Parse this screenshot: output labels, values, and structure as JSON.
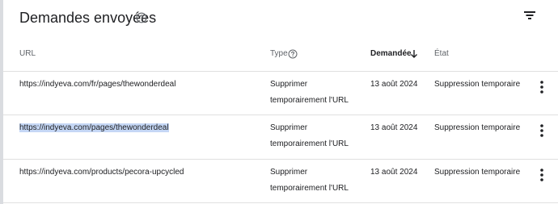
{
  "header": {
    "title": "Demandes envoyées",
    "help_icon": "help-circle-icon",
    "filter_icon": "filter-list-icon"
  },
  "table": {
    "columns": {
      "url": "URL",
      "type": "Type",
      "date": "Demandée",
      "state": "État"
    },
    "sort": {
      "column": "date",
      "direction": "descending",
      "icon": "arrow-down-icon"
    },
    "rows": [
      {
        "url": "https://indyeva.com/fr/pages/thewonderdeal",
        "type_line1": "Supprimer",
        "type_line2": "temporairement l'URL",
        "date": "13 août 2024",
        "state": "Suppression temporaire"
      },
      {
        "url": "https://indyeva.com/pages/thewonderdeal",
        "type_line1": "Supprimer",
        "type_line2": "temporairement l'URL",
        "date": "13 août 2024",
        "state": "Suppression temporaire",
        "selected": true
      },
      {
        "url": "https://indyeva.com/products/pecora-upcycled",
        "type_line1": "Supprimer",
        "type_line2": "temporairement l'URL",
        "date": "13 août 2024",
        "state": "Suppression temporaire"
      }
    ],
    "row_menu_icon": "more-vert-icon"
  },
  "colors": {
    "text": "#202124",
    "muted": "#5f6368",
    "divider": "#e0e0e0",
    "selection": "#c5d7f5"
  }
}
